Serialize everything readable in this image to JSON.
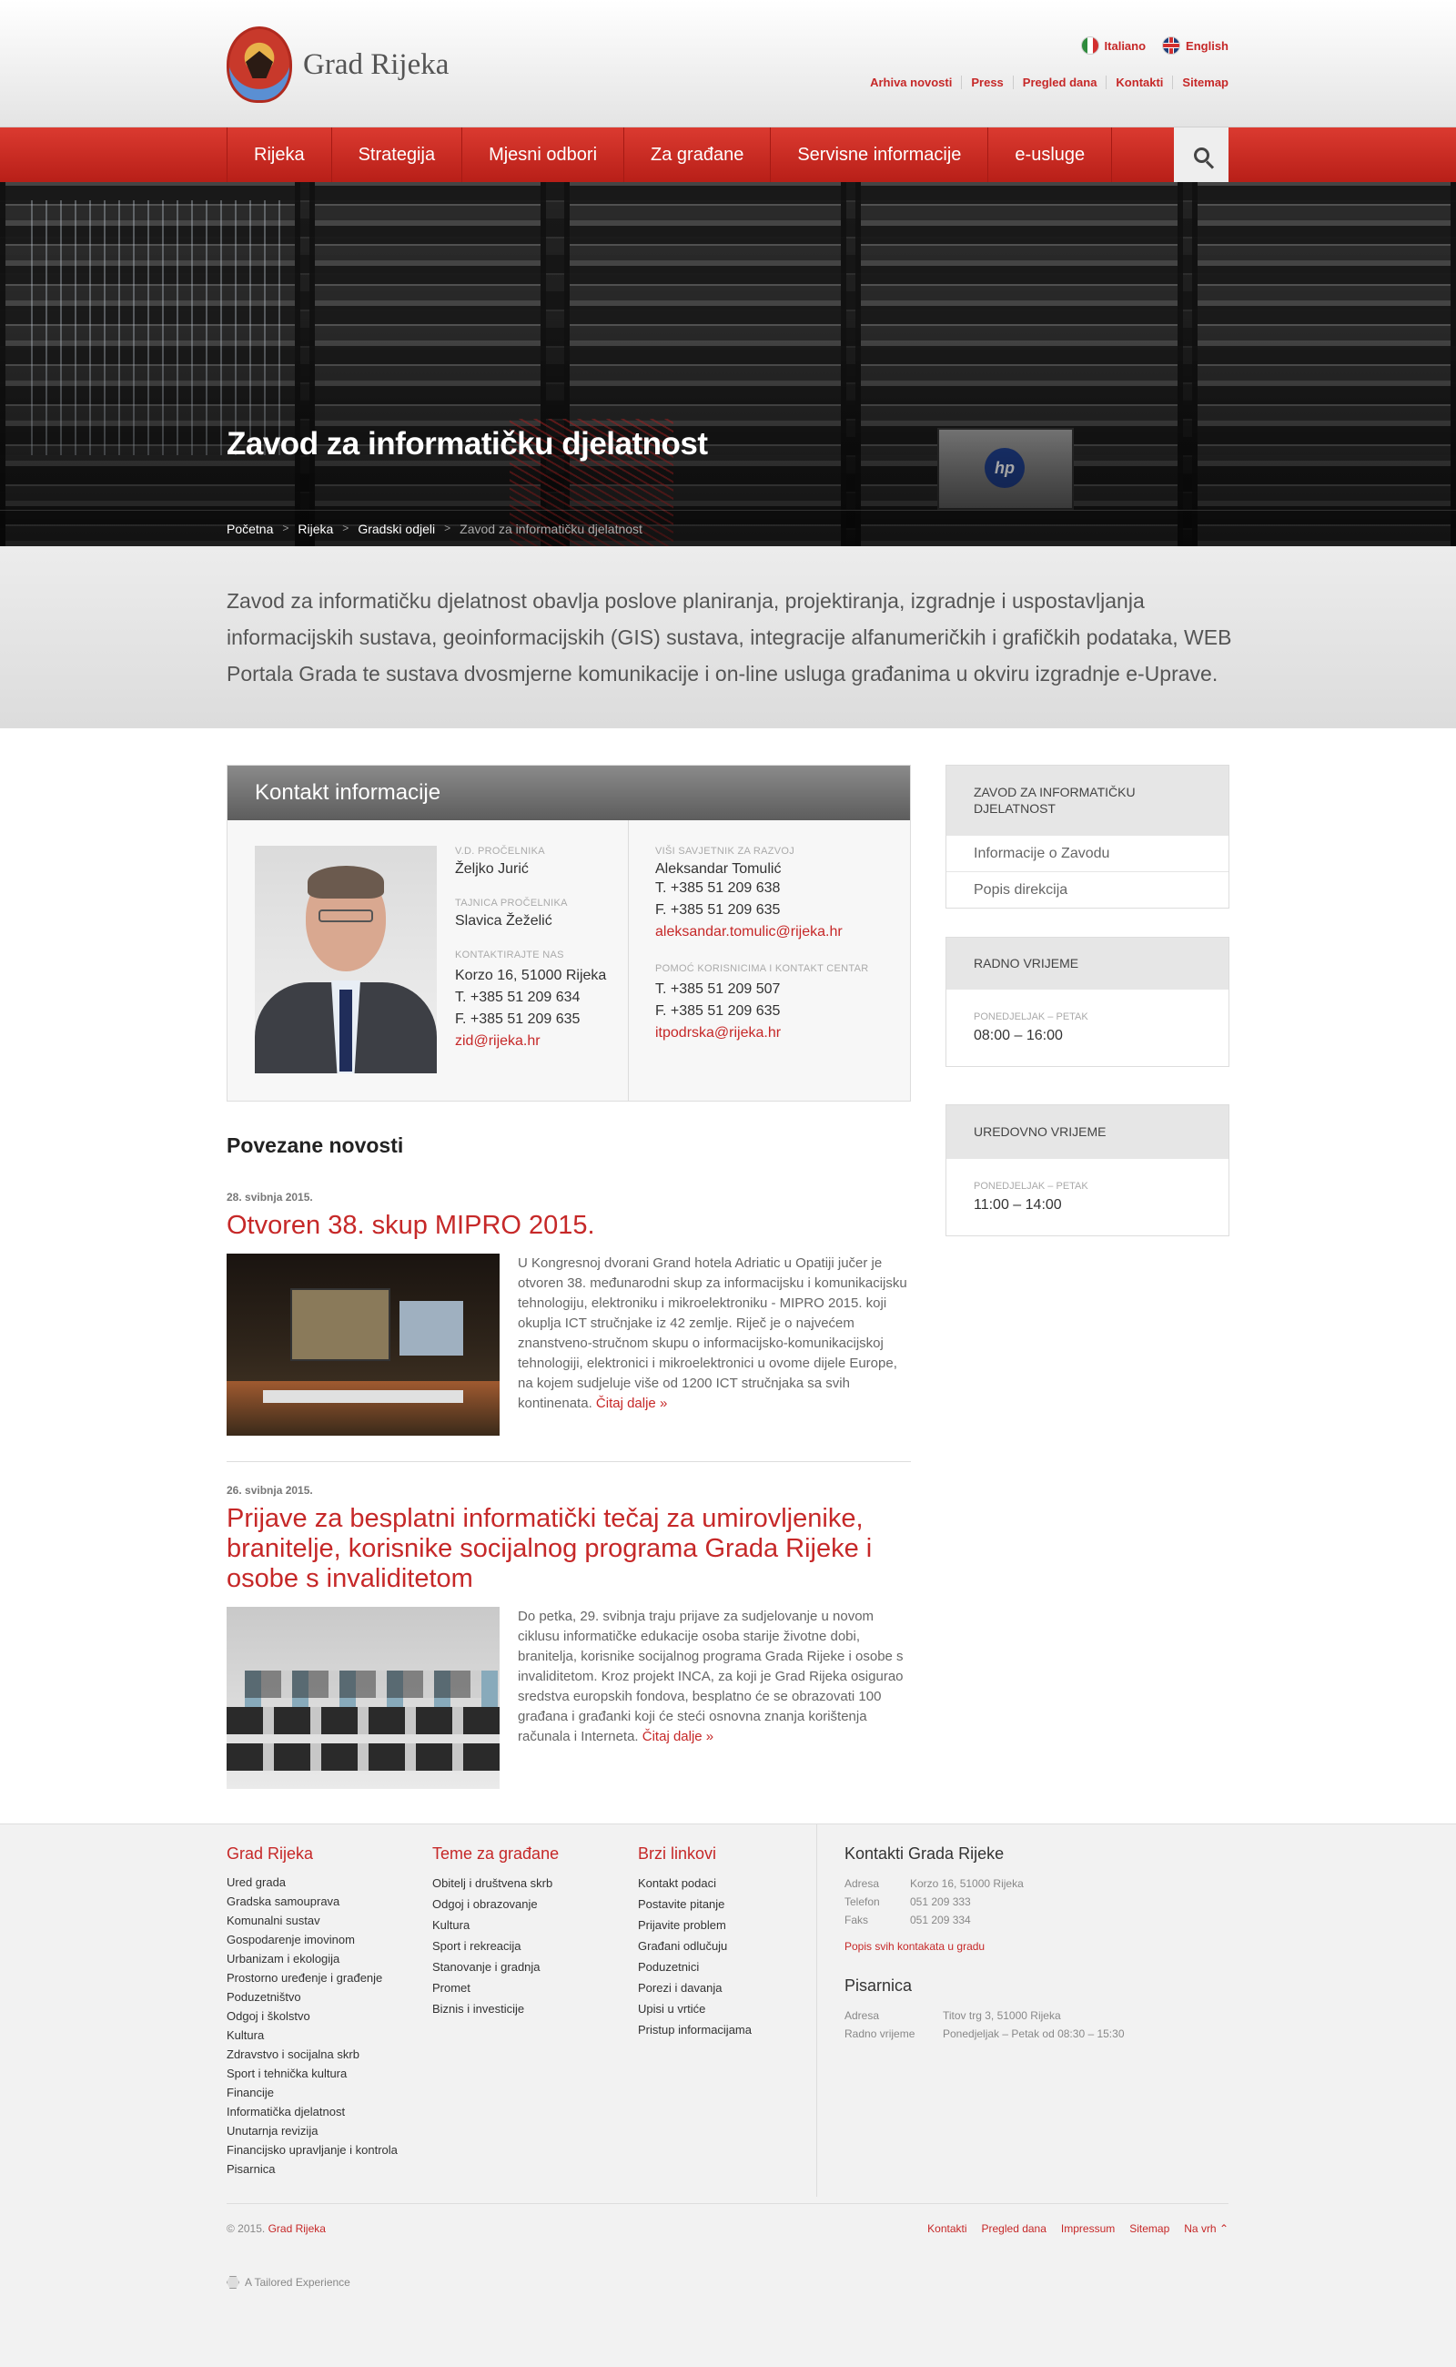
{
  "header": {
    "logo_text": "Grad Rijeka",
    "languages": [
      {
        "label": "Italiano",
        "icon": "italy-flag-icon"
      },
      {
        "label": "English",
        "icon": "uk-flag-icon"
      }
    ],
    "utility_links": [
      "Arhiva novosti",
      "Press",
      "Pregled dana",
      "Kontakti",
      "Sitemap"
    ]
  },
  "nav": {
    "items": [
      "Rijeka",
      "Strategija",
      "Mjesni odbori",
      "Za građane",
      "Servisne informacije",
      "e-usluge"
    ],
    "search_icon": "search-icon"
  },
  "hero": {
    "title": "Zavod za informatičku djelatnost",
    "breadcrumb": [
      "Početna",
      "Rijeka",
      "Gradski odjeli",
      "Zavod za informatičku djelatnost"
    ]
  },
  "intro": "Zavod za informatičku djelatnost obavlja poslove planiranja, projektiranja, izgradnje i uspostavljanja informacijskih sustava, geoinformacijskih (GIS) sustava, integracije alfanumeričkih i grafičkih podataka, WEB Portala Grada te sustava dvosmjerne komunikacije i on-line usluga građanima u okviru izgradnje e-Uprave.",
  "contact": {
    "title": "Kontakt informacije",
    "left": {
      "head_label": "V.D. pročelnika",
      "head_name": "Željko Jurić",
      "secretary_label": "Tajnica pročelnika",
      "secretary_name": "Slavica Žeželić",
      "contact_label": "Kontaktirajte nas",
      "address": "Korzo 16, 51000 Rijeka",
      "phone": "T. +385 51 209 634",
      "fax": "F. +385 51 209 635",
      "email": "zid@rijeka.hr"
    },
    "right": {
      "advisor_label": "Viši savjetnik za razvoj",
      "advisor_name": "Aleksandar Tomulić",
      "advisor_phone": "T. +385 51 209 638",
      "advisor_fax": "F. +385 51 209 635",
      "advisor_email": "aleksandar.tomulic@rijeka.hr",
      "support_label": "Pomoć korisnicima i kontakt centar",
      "support_phone": "T. +385 51 209 507",
      "support_fax": "F. +385 51 209 635",
      "support_email": "itpodrska@rijeka.hr"
    }
  },
  "news": {
    "title": "Povezane novosti",
    "read_more": "Čitaj dalje »",
    "items": [
      {
        "date": "28. svibnja 2015.",
        "headline": "Otvoren 38. skup MIPRO 2015.",
        "text": "U Kongresnoj dvorani Grand hotela Adriatic u Opatiji jučer je otvoren 38. međunarodni skup za informacijsku i komunikacijsku tehnologiju, elektroniku i mikroelektroniku - MIPRO 2015. koji okuplja ICT stručnjake iz 42 zemlje. Riječ je o najvećem znanstveno-stručnom skupu o informacijsko-komunikacijskoj tehnologiji, elektronici i mikroelektronici u ovome dijele Europe, na kojem sudjeluje više od 1200 ICT stručnjaka sa svih kontinenata."
      },
      {
        "date": "26. svibnja 2015.",
        "headline": "Prijave za besplatni informatički tečaj za umirovljenike, branitelje, korisnike socijalnog programa Grada Rijeke i osobe s invaliditetom",
        "text": "Do petka, 29. svibnja traju prijave za sudjelovanje u novom ciklusu informatičke edukacije osoba starije životne dobi, branitelja, korisnike socijalnog programa Grada Rijeke i osobe s invaliditetom. Kroz projekt INCA, za koji je Grad Rijeka osigurao sredstva europskih fondova, besplatno će se obrazovati 100 građana i građanki koji će steći osnovna znanja korištenja računala i Interneta."
      }
    ]
  },
  "sidebar": {
    "menu_title": "Zavod za informatičku djelatnost",
    "menu_items": [
      "Informacije o Zavodu",
      "Popis direkcija"
    ],
    "hours": {
      "title": "Radno vrijeme",
      "days": "Ponedjeljak – Petak",
      "time": "08:00 – 16:00"
    },
    "office_hours": {
      "title": "Uredovno vrijeme",
      "days": "Ponedjeljak – Petak",
      "time": "11:00 – 14:00"
    }
  },
  "footer": {
    "col1": {
      "title": "Grad Rijeka",
      "items": [
        "Ured grada",
        "Gradska samouprava",
        "Komunalni sustav",
        "Gospodarenje imovinom",
        "Urbanizam i ekologija",
        "Prostorno uređenje i građenje",
        "Poduzetništvo",
        "Odgoj i školstvo",
        "Kultura",
        "Zdravstvo i socijalna skrb",
        "Sport i tehnička kultura",
        "Financije",
        "Informatička djelatnost",
        "Unutarnja revizija",
        "Financijsko upravljanje i kontrola",
        "Pisarnica"
      ]
    },
    "col2": {
      "title": "Teme za građane",
      "items": [
        "Obitelj i društvena skrb",
        "Odgoj i obrazovanje",
        "Kultura",
        "Sport i rekreacija",
        "Stanovanje i gradnja",
        "Promet",
        "Biznis i investicije"
      ]
    },
    "col3": {
      "title": "Brzi linkovi",
      "items": [
        "Kontakt podaci",
        "Postavite pitanje",
        "Prijavite problem",
        "Građani odlučuju",
        "Poduzetnici",
        "Porezi i davanja",
        "Upisi u vrtiće",
        "Pristup informacijama"
      ]
    },
    "contacts": {
      "title": "Kontakti Grada Rijeke",
      "rows": [
        {
          "k": "Adresa",
          "v": "Korzo 16, 51000 Rijeka"
        },
        {
          "k": "Telefon",
          "v": "051 209 333"
        },
        {
          "k": "Faks",
          "v": "051 209 334"
        }
      ],
      "link": "Popis svih kontakata u gradu",
      "office_title": "Pisarnica",
      "office_rows": [
        {
          "k": "Adresa",
          "v": "Titov trg 3, 51000 Rijeka"
        },
        {
          "k": "Radno vrijeme",
          "v": "Ponedjeljak – Petak od 08:30 – 15:30"
        }
      ]
    },
    "copyright_prefix": "© 2015.",
    "copyright_name": "Grad Rijeka",
    "bottom_links": [
      "Kontakti",
      "Pregled dana",
      "Impressum",
      "Sitemap",
      "Na vrh ⌃"
    ],
    "credit": "A Tailored Experience"
  }
}
